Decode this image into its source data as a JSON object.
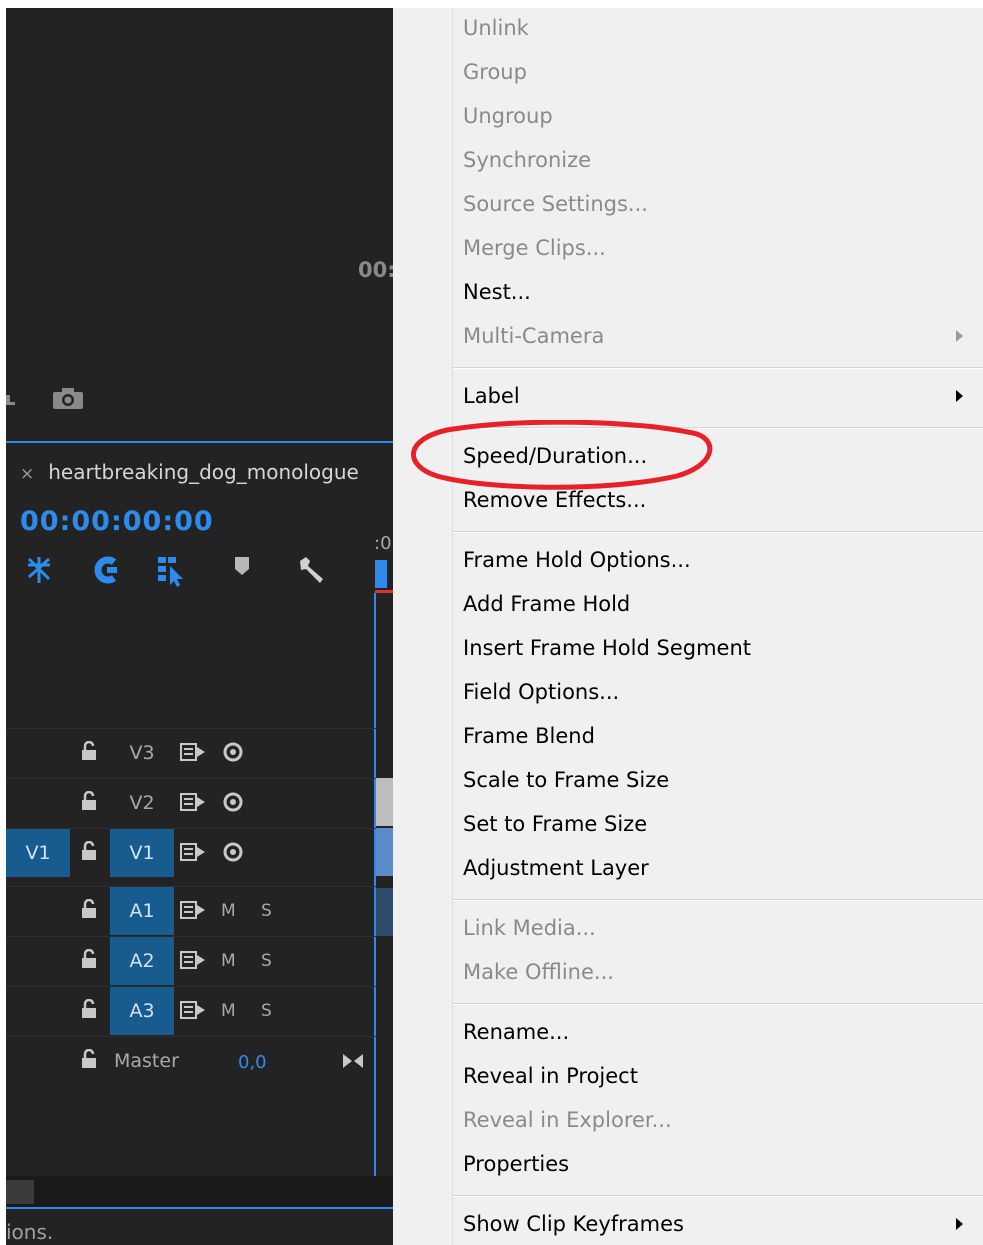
{
  "program_monitor": {
    "timecode": "00:"
  },
  "timeline": {
    "tab_close": "×",
    "sequence_name": "heartbreaking_dog_monologue",
    "timecode": "00:00:00:00",
    "ruler_tick": ":0",
    "tracks": [
      {
        "target": "V3",
        "source": "",
        "type": "video"
      },
      {
        "target": "V2",
        "source": "",
        "type": "video"
      },
      {
        "target": "V1",
        "source": "V1",
        "type": "video"
      },
      {
        "target": "A1",
        "source": "",
        "type": "audio",
        "mute": "M",
        "solo": "S"
      },
      {
        "target": "A2",
        "source": "",
        "type": "audio",
        "mute": "M",
        "solo": "S"
      },
      {
        "target": "A3",
        "source": "",
        "type": "audio",
        "mute": "M",
        "solo": "S"
      }
    ],
    "master": {
      "label": "Master",
      "value": "0,0"
    }
  },
  "status_bar": {
    "text": "ions."
  },
  "colors": {
    "accent": "#2d8ceb",
    "patch": "#185b8e",
    "annotation": "#e8202a"
  },
  "context_menu": {
    "items": [
      {
        "label": "Unlink",
        "enabled": false
      },
      {
        "label": "Group",
        "enabled": false
      },
      {
        "label": "Ungroup",
        "enabled": false
      },
      {
        "label": "Synchronize",
        "enabled": false
      },
      {
        "label": "Source Settings...",
        "enabled": false
      },
      {
        "label": "Merge Clips...",
        "enabled": false
      },
      {
        "label": "Nest...",
        "enabled": true
      },
      {
        "label": "Multi-Camera",
        "enabled": false,
        "submenu": true
      },
      {
        "label": "Label",
        "enabled": true,
        "submenu": true
      },
      {
        "label": "Speed/Duration...",
        "enabled": true,
        "highlighted_by_annotation": true
      },
      {
        "label": "Remove Effects...",
        "enabled": true
      },
      {
        "label": "Frame Hold Options...",
        "enabled": true
      },
      {
        "label": "Add Frame Hold",
        "enabled": true
      },
      {
        "label": "Insert Frame Hold Segment",
        "enabled": true
      },
      {
        "label": "Field Options...",
        "enabled": true
      },
      {
        "label": "Frame Blend",
        "enabled": true
      },
      {
        "label": "Scale to Frame Size",
        "enabled": true
      },
      {
        "label": "Set to Frame Size",
        "enabled": true
      },
      {
        "label": "Adjustment Layer",
        "enabled": true
      },
      {
        "label": "Link Media...",
        "enabled": false
      },
      {
        "label": "Make Offline...",
        "enabled": false
      },
      {
        "label": "Rename...",
        "enabled": true
      },
      {
        "label": "Reveal in Project",
        "enabled": true
      },
      {
        "label": "Reveal in Explorer...",
        "enabled": false
      },
      {
        "label": "Properties",
        "enabled": true
      },
      {
        "label": "Show Clip Keyframes",
        "enabled": true,
        "submenu": true
      }
    ]
  }
}
